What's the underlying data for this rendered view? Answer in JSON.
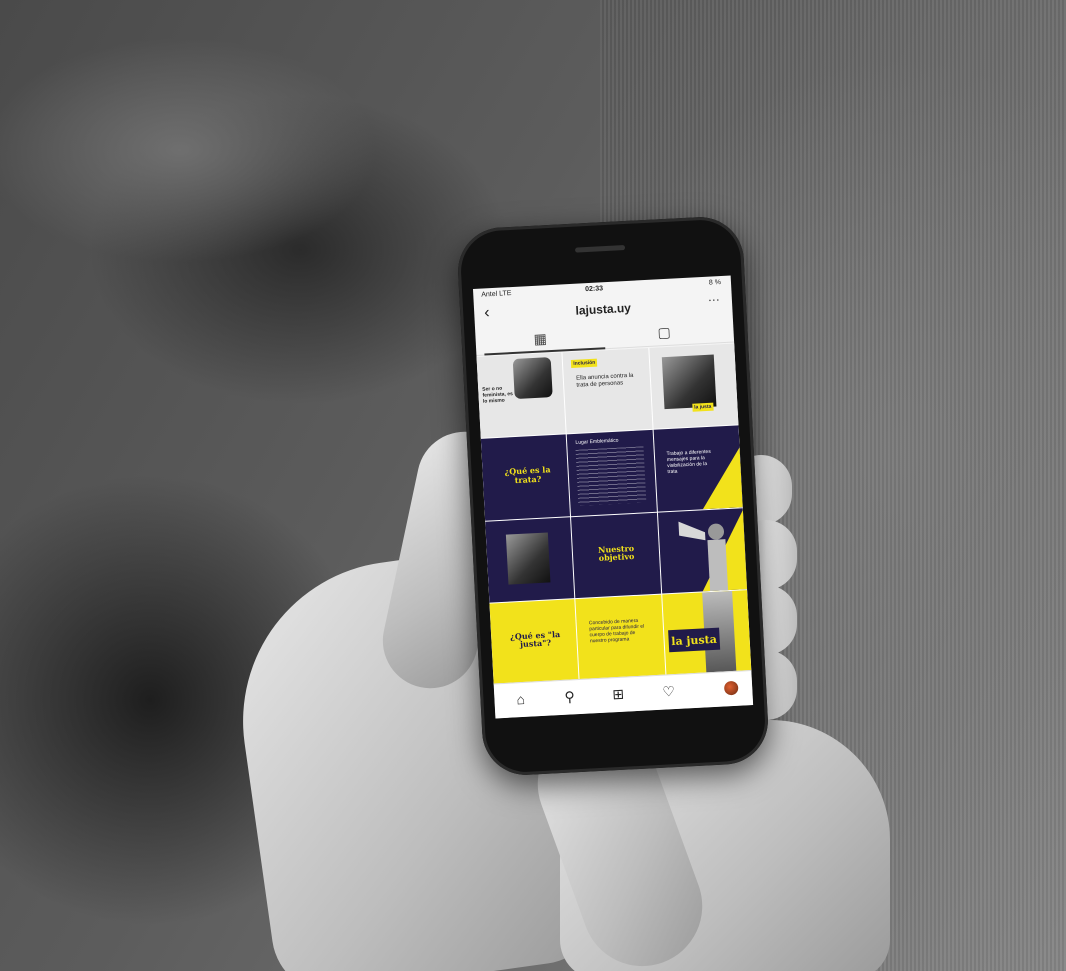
{
  "status_bar": {
    "carrier": "Antel LTE",
    "time": "02:33",
    "battery": "8 %"
  },
  "profile": {
    "username": "lajusta.uy",
    "back_icon": "chevron-left-icon",
    "more_icon": "more-dots-icon"
  },
  "tabs": {
    "grid_icon": "grid-icon",
    "tagged_icon": "tagged-icon"
  },
  "posts": {
    "p1_label": "Ser o no feminista, es lo mismo",
    "p2_tag": "Inclusión",
    "p2_text": "Ella anuncia contra la trata de personas",
    "p3_label": "la justa",
    "p4_text": "¿Qué es la trata?",
    "p5_title": "Lugar Emblemático",
    "p6_text": "Trabajo a diferentes mensajes para la visibilización de la trata",
    "p8_text": "Nuestro objetivo",
    "p10_text": "¿Qué es \"la justa\"?",
    "p11_text": "Concebido de manera particular para difundir el cuerpo de trabajo de nuestro programa",
    "p12_text": "la justa"
  },
  "bottom_nav": {
    "home": "home-icon",
    "search": "search-icon",
    "add": "add-icon",
    "heart": "heart-icon",
    "profile": "profile-avatar"
  },
  "colors": {
    "navy": "#211b4a",
    "yellow": "#f2e21b"
  }
}
